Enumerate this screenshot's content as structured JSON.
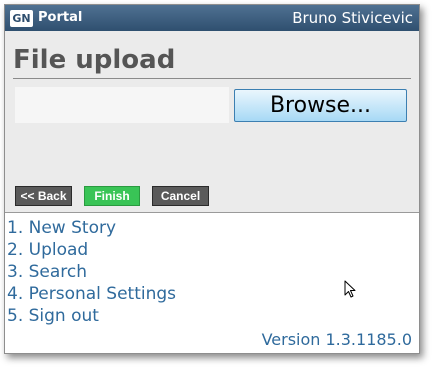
{
  "header": {
    "logo_badge": "GN",
    "logo_text": "Portal",
    "user_name": "Bruno Stivicevic"
  },
  "upload": {
    "title": "File upload",
    "file_value": "",
    "browse_label": "Browse...",
    "back_label": "<< Back",
    "finish_label": "Finish",
    "cancel_label": "Cancel"
  },
  "menu": {
    "items": [
      {
        "label": "1. New Story"
      },
      {
        "label": "2. Upload"
      },
      {
        "label": "3. Search"
      },
      {
        "label": "4. Personal Settings"
      },
      {
        "label": "5. Sign out"
      }
    ]
  },
  "footer": {
    "version": "Version 1.3.1185.0"
  },
  "icons": {
    "cursor": "mouse-pointer-icon"
  },
  "colors": {
    "titlebar": "#3a5b7c",
    "panel": "#ebebeb",
    "link": "#2f6a9c",
    "finish": "#39c456",
    "dark_button": "#5a5a5a",
    "browse_button": "#bfe3f8"
  }
}
